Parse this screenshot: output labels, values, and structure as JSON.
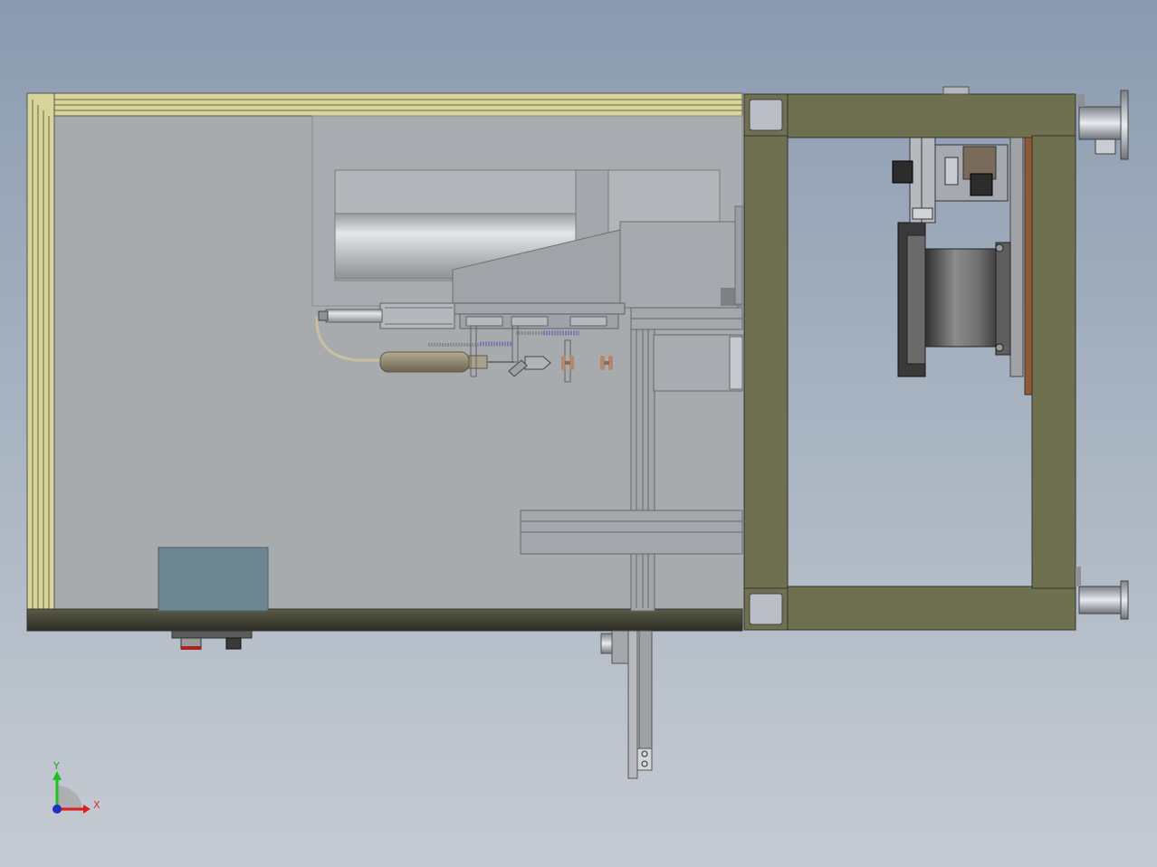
{
  "view": {
    "background_top": "#8b9bb0",
    "background_bottom": "#c5cbd2"
  },
  "colors": {
    "enclosure_frame": "#d8d49a",
    "enclosure_panel": "#a8abae",
    "base_rail": "#4a4a3c",
    "olive_frame": "#6f7050",
    "corner_block": "#b9bec6",
    "cabinet_box": "#6d8691",
    "axis_x": "#e02020",
    "axis_y": "#20c020",
    "axis_z": "#2030c0"
  },
  "triad": {
    "x_label": "X",
    "y_label": "Y",
    "x_icon": "x-axis-arrow-icon",
    "y_icon": "y-axis-arrow-icon",
    "z_icon": "z-axis-dot-icon"
  }
}
